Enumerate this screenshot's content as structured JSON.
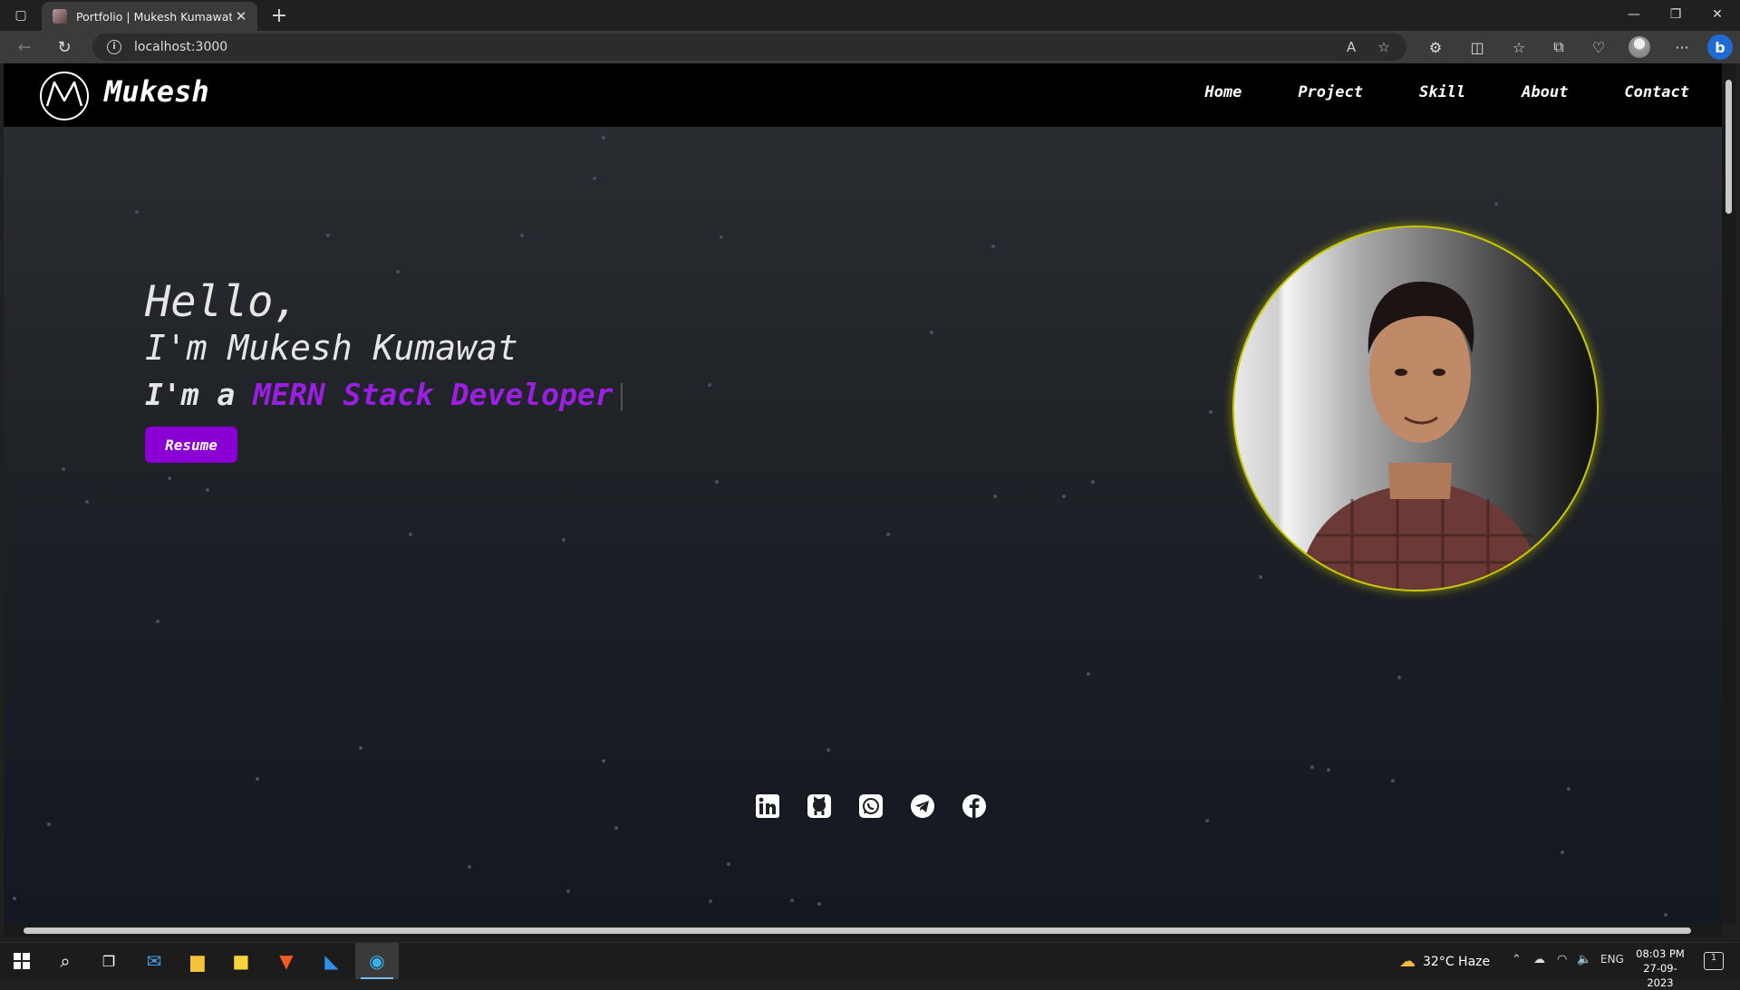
{
  "browser": {
    "tab_title": "Portfolio | Mukesh Kumawat",
    "tab_close": "✕",
    "new_tab": "+",
    "url": "localhost:3000",
    "window_controls": {
      "minimize": "—",
      "restore": "❐",
      "close": "✕"
    },
    "toolbar": {
      "more": "···",
      "bing": "b"
    }
  },
  "site": {
    "brand": "Mukesh",
    "nav": [
      "Home",
      "Project",
      "Skill",
      "About",
      "Contact"
    ],
    "hero": {
      "hello": "Hello,",
      "name_line": "I'm Mukesh Kumawat",
      "role_prefix": "I'm a",
      "role": "MERN Stack Developer",
      "resume_label": "Resume"
    },
    "social": [
      "linkedin-icon",
      "github-icon",
      "whatsapp-icon",
      "telegram-icon",
      "facebook-icon"
    ],
    "colors": {
      "accent": "#9a1fe3",
      "button": "#8a00d4",
      "ring": "#c9c900",
      "nav_bg": "#000000"
    }
  },
  "taskbar": {
    "weather": "32°C  Haze",
    "lang": "ENG",
    "time": "08:03 PM",
    "date": "27-09-2023",
    "notifications": "1"
  }
}
